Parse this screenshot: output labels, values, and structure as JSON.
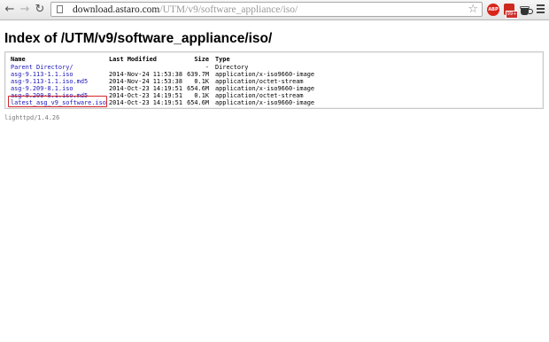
{
  "browser": {
    "url_host": "download.astaro.com",
    "url_path": "/UTM/v9/software_appliance/iso/",
    "abp_label": "ABP",
    "ext_badge": "99+"
  },
  "page": {
    "title": "Index of /UTM/v9/software_appliance/iso/",
    "columns": {
      "name": "Name",
      "modified": "Last Modified",
      "size": "Size",
      "type": "Type"
    },
    "rows": [
      {
        "name": "Parent Directory/",
        "modified": "",
        "size": "-",
        "type": "Directory"
      },
      {
        "name": "asg-9.113-1.1.iso",
        "modified": "2014-Nov-24 11:53:38",
        "size": "639.7M",
        "type": "application/x-iso9660-image"
      },
      {
        "name": "asg-9.113-1.1.iso.md5",
        "modified": "2014-Nov-24 11:53:38",
        "size": "0.1K",
        "type": "application/octet-stream"
      },
      {
        "name": "asg-9.209-8.1.iso",
        "modified": "2014-Oct-23 14:19:51",
        "size": "654.6M",
        "type": "application/x-iso9660-image"
      },
      {
        "name": "asg-9.209-8.1.iso.md5",
        "modified": "2014-Oct-23 14:19:51",
        "size": "0.1K",
        "type": "application/octet-stream"
      },
      {
        "name": "latest_asg_v9_software.iso",
        "modified": "2014-Oct-23 14:19:51",
        "size": "654.6M",
        "type": "application/x-iso9660-image"
      }
    ],
    "server": "lighttpd/1.4.26"
  }
}
